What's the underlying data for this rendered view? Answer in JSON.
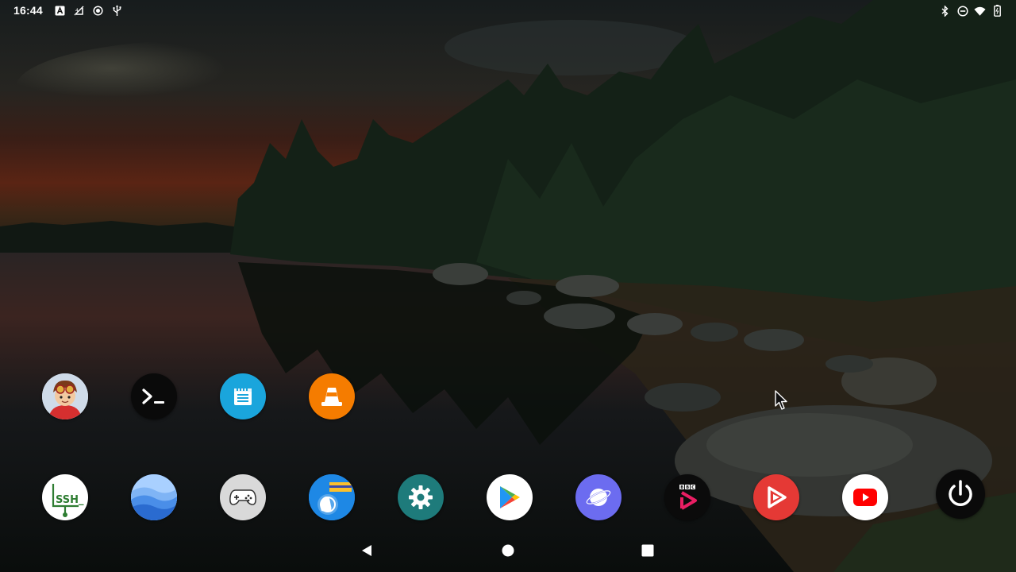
{
  "status_bar": {
    "time": "16:44",
    "left_icons": [
      "font-a-icon",
      "mobile-data-off-icon",
      "record-icon",
      "usb-icon"
    ],
    "right_icons": [
      "bluetooth-icon",
      "do-not-disturb-icon",
      "wifi-icon",
      "battery-icon"
    ]
  },
  "apps_row1": [
    {
      "name": "avatar-app",
      "icon": "cartoon-avatar-icon"
    },
    {
      "name": "terminal-app",
      "icon": "terminal-prompt-icon"
    },
    {
      "name": "notes-app",
      "icon": "notepad-icon"
    },
    {
      "name": "vlc-app",
      "icon": "traffic-cone-icon"
    }
  ],
  "apps_row2": [
    {
      "name": "ssh-app",
      "icon": "ssh-icon",
      "label": "SSH_"
    },
    {
      "name": "earth-app",
      "icon": "waves-icon"
    },
    {
      "name": "game-app",
      "icon": "gamepad-icon"
    },
    {
      "name": "files-app",
      "icon": "folder-hand-icon"
    },
    {
      "name": "settings-app",
      "icon": "gear-icon"
    },
    {
      "name": "play-store-app",
      "icon": "play-store-icon"
    },
    {
      "name": "browser-app",
      "icon": "planet-icon"
    },
    {
      "name": "bbc-iplayer-app",
      "icon": "bbc-play-icon",
      "label": "BBC"
    },
    {
      "name": "video-app",
      "icon": "red-play-icon"
    },
    {
      "name": "youtube-app",
      "icon": "youtube-icon"
    },
    {
      "name": "power-app",
      "icon": "power-icon"
    }
  ],
  "navigation": {
    "back": "back-triangle-icon",
    "home": "home-circle-icon",
    "recents": "recents-square-icon"
  },
  "colors": {
    "terminal_bg": "#0a0a0a",
    "notes_bg": "#1aa5dc",
    "vlc_bg": "#f57c00",
    "ssh_green": "#2e7d32",
    "settings_bg": "#1e7b7b",
    "browser_bg": "#6c6cf0",
    "video_bg": "#e53935",
    "youtube_red": "#ff0000"
  }
}
